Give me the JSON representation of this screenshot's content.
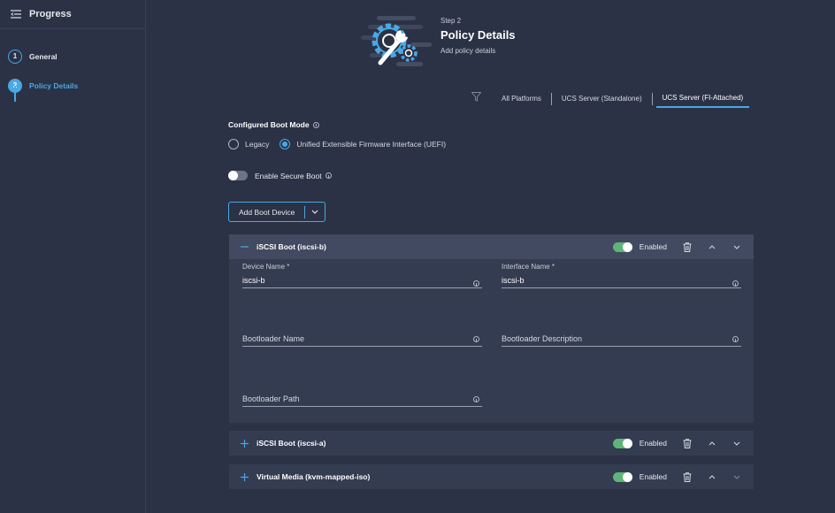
{
  "sidebar": {
    "title": "Progress",
    "steps": [
      {
        "number": "1",
        "label": "General"
      },
      {
        "number": "2",
        "label": "Policy Details"
      }
    ]
  },
  "header": {
    "step_label": "Step 2",
    "title": "Policy Details",
    "subtitle": "Add policy details"
  },
  "platforms": {
    "tabs": [
      "All Platforms",
      "UCS Server (Standalone)",
      "UCS Server (FI-Attached)"
    ],
    "active": "UCS Server (FI-Attached)"
  },
  "boot_mode": {
    "label": "Configured Boot Mode",
    "options": [
      "Legacy",
      "Unified Extensible Firmware Interface (UEFI)"
    ],
    "selected": "Unified Extensible Firmware Interface (UEFI)"
  },
  "secure_boot": {
    "label": "Enable Secure Boot",
    "enabled": false
  },
  "add_boot_device": {
    "label": "Add Boot Device"
  },
  "boot_devices": [
    {
      "title": "iSCSI Boot (iscsi-b)",
      "expanded": true,
      "enabled_label": "Enabled",
      "fields": {
        "device_name": {
          "label": "Device Name *",
          "value": "iscsi-b"
        },
        "interface_name": {
          "label": "Interface Name *",
          "value": "iscsi-b"
        },
        "bootloader_name": {
          "placeholder": "Bootloader Name"
        },
        "bootloader_description": {
          "placeholder": "Bootloader Description"
        },
        "bootloader_path": {
          "placeholder": "Bootloader Path"
        }
      }
    },
    {
      "title": "iSCSI Boot (iscsi-a)",
      "expanded": false,
      "enabled_label": "Enabled"
    },
    {
      "title": "Virtual Media (kvm-mapped-iso)",
      "expanded": false,
      "enabled_label": "Enabled"
    }
  ],
  "colors": {
    "background": "#2b3245",
    "panel": "#343c51",
    "accent": "#49a8e5",
    "toggle_on": "#5fb47a"
  }
}
